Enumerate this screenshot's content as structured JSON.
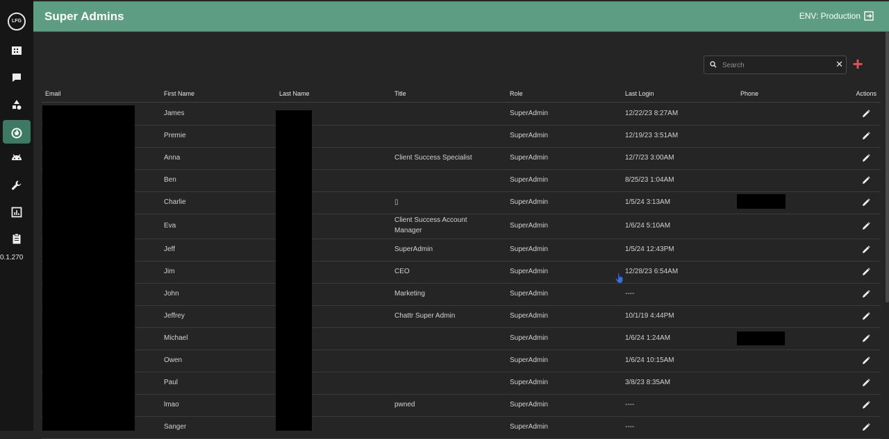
{
  "sidebar": {
    "logo_text": "LFG",
    "version": "0.1.270",
    "items": [
      {
        "icon": "building-icon"
      },
      {
        "icon": "chat-icon"
      },
      {
        "icon": "shapes-icon"
      },
      {
        "icon": "fire-icon",
        "active": true
      },
      {
        "icon": "android-icon"
      },
      {
        "icon": "wrench-icon"
      },
      {
        "icon": "bar-chart-icon"
      },
      {
        "icon": "clipboard-icon"
      }
    ]
  },
  "header": {
    "title": "Super Admins",
    "env_label": "ENV: Production"
  },
  "search": {
    "placeholder": "Search",
    "value": ""
  },
  "table": {
    "columns": [
      "Email",
      "First Name",
      "Last Name",
      "Title",
      "Role",
      "Last Login",
      "Phone",
      "Actions"
    ],
    "rows": [
      {
        "first": "James",
        "title": "",
        "role": "SuperAdmin",
        "last_login": "12/22/23 8:27AM"
      },
      {
        "first": "Premie",
        "title": "",
        "role": "SuperAdmin",
        "last_login": "12/19/23 3:51AM"
      },
      {
        "first": "Anna",
        "title": "Client Success Specialist",
        "role": "SuperAdmin",
        "last_login": "12/7/23 3:00AM"
      },
      {
        "first": "Ben",
        "title": "",
        "role": "SuperAdmin",
        "last_login": "8/25/23 1:04AM"
      },
      {
        "first": "Charlie",
        "title": "▯",
        "role": "SuperAdmin",
        "last_login": "1/5/24 3:13AM"
      },
      {
        "first": "Eva",
        "title": "Client Success Account Manager",
        "role": "SuperAdmin",
        "last_login": "1/6/24 5:10AM"
      },
      {
        "first": "Jeff",
        "title": "SuperAdmin",
        "role": "SuperAdmin",
        "last_login": "1/5/24 12:43PM"
      },
      {
        "first": "Jim",
        "title": "CEO",
        "role": "SuperAdmin",
        "last_login": "12/28/23 6:54AM"
      },
      {
        "first": "John",
        "title": "Marketing",
        "role": "SuperAdmin",
        "last_login": "----"
      },
      {
        "first": "Jeffrey",
        "title": "Chattr Super Admin",
        "role": "SuperAdmin",
        "last_login": "10/1/19 4:44PM"
      },
      {
        "first": "Michael",
        "title": "",
        "role": "SuperAdmin",
        "last_login": "1/6/24 1:24AM"
      },
      {
        "first": "Owen",
        "title": "",
        "role": "SuperAdmin",
        "last_login": "1/6/24 10:15AM"
      },
      {
        "first": "Paul",
        "title": "",
        "role": "SuperAdmin",
        "last_login": "3/8/23 8:35AM"
      },
      {
        "first": "lmao",
        "title": "pwned",
        "role": "SuperAdmin",
        "last_login": "----"
      },
      {
        "first": "Sanger",
        "title": "",
        "role": "SuperAdmin",
        "last_login": "----"
      }
    ]
  },
  "colors": {
    "header_bg": "#5c9d84",
    "active_nav": "#3c7a64",
    "add_button": "#e0524f",
    "page_bg": "#252525"
  }
}
